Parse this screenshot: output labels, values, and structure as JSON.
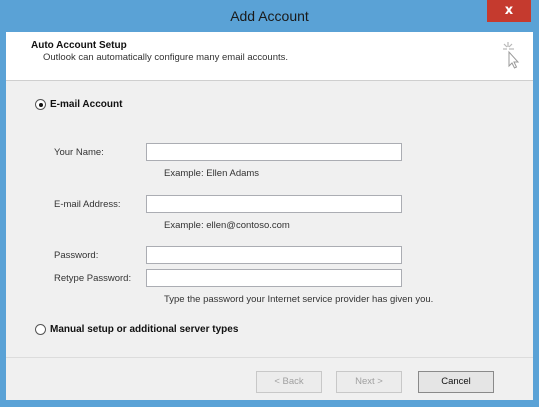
{
  "window": {
    "title": "Add Account",
    "close_glyph": "x"
  },
  "header": {
    "title": "Auto Account Setup",
    "subtitle": "Outlook can automatically configure many email accounts.",
    "icon": "magic-wand-icon"
  },
  "email_option": {
    "label": "E-mail Account",
    "selected": true
  },
  "fields": {
    "name": {
      "label": "Your Name:",
      "value": "",
      "hint": "Example: Ellen Adams"
    },
    "email": {
      "label": "E-mail Address:",
      "value": "",
      "hint": "Example: ellen@contoso.com"
    },
    "password": {
      "label": "Password:",
      "value": ""
    },
    "retype": {
      "label": "Retype Password:",
      "value": ""
    },
    "password_hint": "Type the password your Internet service provider has given you."
  },
  "manual_option": {
    "label": "Manual setup or additional server types",
    "selected": false
  },
  "buttons": {
    "back": "< Back",
    "next": "Next >",
    "cancel": "Cancel"
  },
  "colors": {
    "titlebar": "#5aa2d6",
    "close": "#c53a2e",
    "client": "#f0f0f0"
  }
}
